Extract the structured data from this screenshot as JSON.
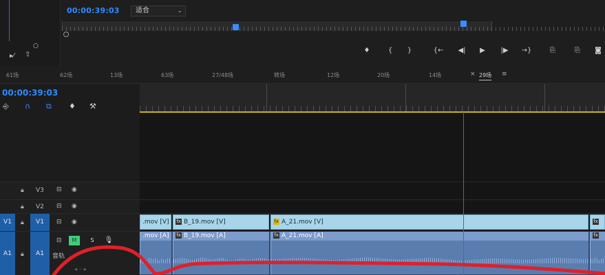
{
  "source_monitor": {
    "timecode": "00:00:39:03",
    "fit_select": "适合"
  },
  "transport": {
    "buttons": [
      "♦",
      "{",
      "}",
      "{←",
      "◀|",
      "▶",
      "|▶",
      "→}",
      "⎘",
      "⎘",
      "◙"
    ]
  },
  "sequence_tabs": [
    "61场",
    "62场",
    "13场",
    "63场",
    "27/48场",
    "转场",
    "12场",
    "20场",
    "14场",
    "29场"
  ],
  "active_tab_index": 9,
  "timeline": {
    "timecode": "00:00:39:03",
    "tracks": {
      "v3": {
        "label": "V3"
      },
      "v2": {
        "label": "V2"
      },
      "v1": {
        "label": "V1",
        "source_tag": "V1"
      },
      "a1": {
        "label": "A1",
        "source_tag": "A1",
        "mute": "M",
        "solo": "S"
      },
      "a1_name_fragment": "音轨"
    },
    "video_clips": [
      {
        "label": ".mov [V]"
      },
      {
        "label": "B_19.mov [V]"
      },
      {
        "label": "A_21.mov [V]"
      },
      {
        "label": ""
      }
    ],
    "audio_clips": [
      {
        "label": ".mov [A]"
      },
      {
        "label": "B_19.mov [A]"
      },
      {
        "label": "A_21.mov [A]"
      },
      {
        "label": ""
      }
    ]
  },
  "colors": {
    "timecode": "#2b8cff",
    "video_clip": "#a8d5ea",
    "audio_clip": "#5a7db0",
    "annotation_stroke": "#e0202a"
  }
}
